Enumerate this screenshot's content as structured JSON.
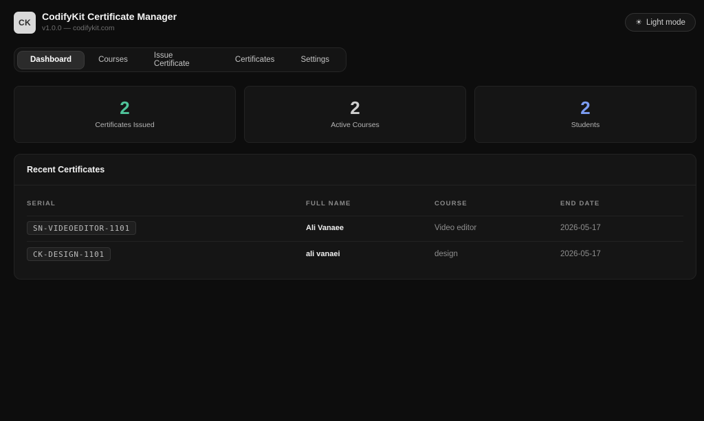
{
  "app": {
    "logo_text": "CK",
    "title": "CodifyKit Certificate Manager",
    "subtitle": "v1.0.0 — codifykit.com",
    "theme_toggle_label": "Light mode",
    "theme_toggle_icon": "sun-icon"
  },
  "tabs": [
    {
      "label": "Dashboard",
      "active": true
    },
    {
      "label": "Courses",
      "active": false
    },
    {
      "label": "Issue Certificate",
      "active": false
    },
    {
      "label": "Certificates",
      "active": false
    },
    {
      "label": "Settings",
      "active": false
    }
  ],
  "stats": [
    {
      "value": "2",
      "label": "Certificates Issued",
      "color": "#4fc39a"
    },
    {
      "value": "2",
      "label": "Active Courses",
      "color": "#cfcfcf"
    },
    {
      "value": "2",
      "label": "Students",
      "color": "#7b9cf2"
    }
  ],
  "recent": {
    "title": "Recent Certificates",
    "columns": [
      "SERIAL",
      "FULL NAME",
      "COURSE",
      "END DATE"
    ],
    "rows": [
      {
        "serial": "SN-VIDEOEDITOR-1101",
        "full_name": "Ali Vanaee",
        "course": "Video editor",
        "end_date": "2026-05-17"
      },
      {
        "serial": "CK-DESIGN-1101",
        "full_name": "ali vanaei",
        "course": "design",
        "end_date": "2026-05-17"
      }
    ]
  }
}
